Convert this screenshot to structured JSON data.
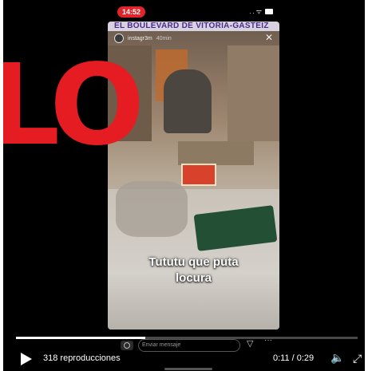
{
  "story": {
    "banner": "EL BOULEVARD DE VITORIA-GASTEIZ",
    "username": "instagr3m",
    "time_ago": "40min",
    "close_glyph": "✕",
    "caption_line1": "Tututu que puta",
    "caption_line2": "locura"
  },
  "status_bar": {
    "clock": "14:52",
    "icons": "..ᯤ"
  },
  "overlay": {
    "text": "LO",
    "color": "#e61c23"
  },
  "message_bar": {
    "placeholder": "Enviar mensaje",
    "send_icon": "send-icon",
    "more_icon": "more-icon"
  },
  "player": {
    "views": "318 reproducciones",
    "time": "0:11 / 0:29",
    "progress": 0.379,
    "volume_glyph": "🔈",
    "fullscreen_glyph": "⤢",
    "icons": [
      "play-icon",
      "volume-icon",
      "fullscreen-icon"
    ]
  }
}
